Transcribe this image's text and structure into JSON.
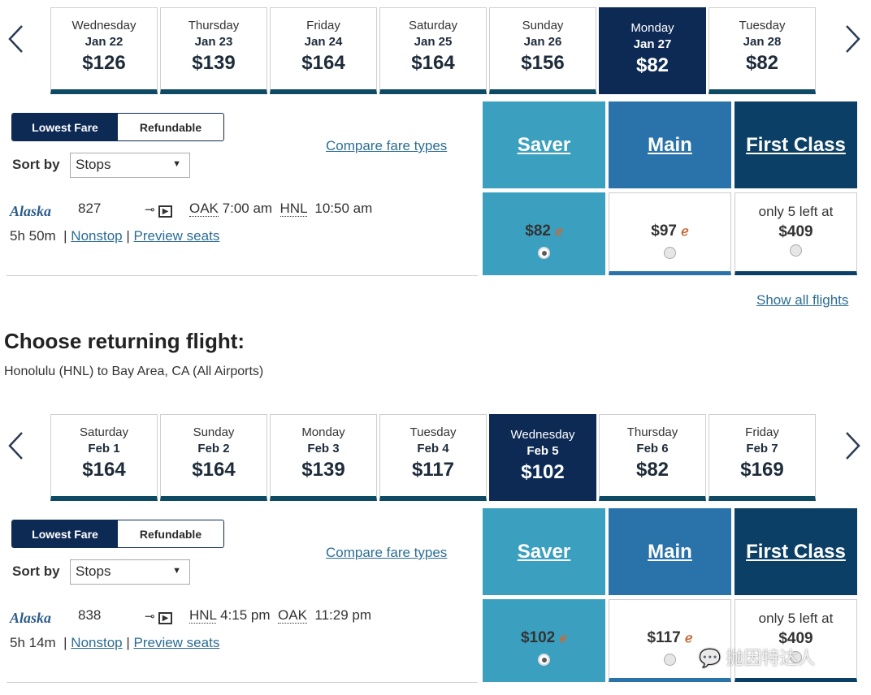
{
  "outbound": {
    "dates": [
      {
        "day": "Wednesday",
        "date": "Jan 22",
        "price": "$126"
      },
      {
        "day": "Thursday",
        "date": "Jan 23",
        "price": "$139"
      },
      {
        "day": "Friday",
        "date": "Jan 24",
        "price": "$164"
      },
      {
        "day": "Saturday",
        "date": "Jan 25",
        "price": "$164"
      },
      {
        "day": "Sunday",
        "date": "Jan 26",
        "price": "$156"
      },
      {
        "day": "Monday",
        "date": "Jan 27",
        "price": "$82",
        "selected": true
      },
      {
        "day": "Tuesday",
        "date": "Jan 28",
        "price": "$82"
      }
    ],
    "toggle": {
      "lowest": "Lowest Fare",
      "refundable": "Refundable"
    },
    "sort_label": "Sort by",
    "sort_value": "Stops",
    "compare": "Compare fare types",
    "fare_headers": {
      "saver": "Saver",
      "main": "Main",
      "first": "First Class"
    },
    "flight": {
      "airline": "Alaska",
      "number": "827",
      "from": "OAK",
      "depart": "7:00 am",
      "to": "HNL",
      "arrive": "10:50 am",
      "duration": "5h 50m",
      "stops": "Nonstop",
      "preview": "Preview seats",
      "saver_price": "$82",
      "main_price": "$97",
      "first_note": "only 5 left at",
      "first_price": "$409",
      "selected_fare": "saver"
    },
    "show_all": "Show all flights"
  },
  "return_heading": "Choose returning flight:",
  "return_route": "Honolulu (HNL) to Bay Area, CA (All Airports)",
  "inbound": {
    "dates": [
      {
        "day": "Saturday",
        "date": "Feb 1",
        "price": "$164"
      },
      {
        "day": "Sunday",
        "date": "Feb 2",
        "price": "$164"
      },
      {
        "day": "Monday",
        "date": "Feb 3",
        "price": "$139"
      },
      {
        "day": "Tuesday",
        "date": "Feb 4",
        "price": "$117"
      },
      {
        "day": "Wednesday",
        "date": "Feb 5",
        "price": "$102",
        "selected": true
      },
      {
        "day": "Thursday",
        "date": "Feb 6",
        "price": "$82"
      },
      {
        "day": "Friday",
        "date": "Feb 7",
        "price": "$169"
      }
    ],
    "toggle": {
      "lowest": "Lowest Fare",
      "refundable": "Refundable"
    },
    "sort_label": "Sort by",
    "sort_value": "Stops",
    "compare": "Compare fare types",
    "fare_headers": {
      "saver": "Saver",
      "main": "Main",
      "first": "First Class"
    },
    "flight": {
      "airline": "Alaska",
      "number": "838",
      "from": "HNL",
      "depart": "4:15 pm",
      "to": "OAK",
      "arrive": "11:29 pm",
      "duration": "5h 14m",
      "stops": "Nonstop",
      "preview": "Preview seats",
      "saver_price": "$102",
      "main_price": "$117",
      "first_note": "only 5 left at",
      "first_price": "$409",
      "selected_fare": "saver"
    }
  },
  "watermark": "抛因特达人",
  "colors": {
    "saver": "#3ba0c0",
    "main": "#2a72aa",
    "first": "#0b3f66",
    "selected_date": "#0d2a55",
    "tile_bar": "#0e4a63"
  }
}
